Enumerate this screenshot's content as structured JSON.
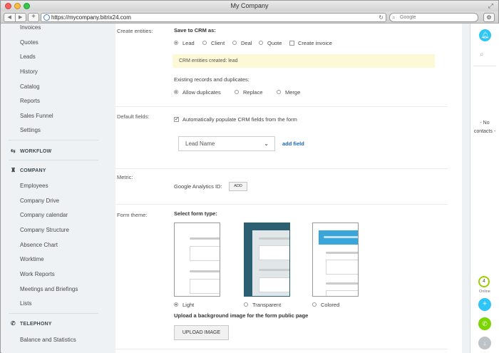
{
  "window": {
    "title": "My Company"
  },
  "browser": {
    "back": "◀",
    "forward": "▶",
    "new_tab": "+",
    "url": "https://mycompany.bitrix24.com",
    "search_placeholder": "Google"
  },
  "sidebar": {
    "items_top": [
      "Invoices",
      "Quotes",
      "Leads",
      "History",
      "Catalog",
      "Reports",
      "Sales Funnel",
      "Settings"
    ],
    "section_workflow": "WORKFLOW",
    "section_company": "COMPANY",
    "company_items": [
      "Employees",
      "Company Drive",
      "Company calendar",
      "Company Structure",
      "Absence Chart",
      "Worktime",
      "Work Reports",
      "Meetings and Briefings",
      "Lists"
    ],
    "section_telephony": "TELEPHONY",
    "telephony_items": [
      "Balance and Statistics"
    ]
  },
  "form": {
    "create_entities": {
      "label": "Create entities:",
      "heading": "Save to CRM as:",
      "options": [
        "Lead",
        "Client",
        "Deal",
        "Quote"
      ],
      "selected": "Lead",
      "invoice_label": "Create invoice",
      "notice": "CRM entities created: lead",
      "duplicates_label": "Existing records and duplicates:",
      "duplicate_options": [
        "Allow duplicates",
        "Replace",
        "Merge"
      ],
      "duplicate_selected": "Allow duplicates"
    },
    "default_fields": {
      "label": "Default fields:",
      "auto_populate": "Automatically populate CRM fields from the form",
      "auto_populate_checked": true,
      "field_value": "Lead Name",
      "add_field": "add field"
    },
    "metric": {
      "label": "Metric:",
      "ga_label": "Google Analytics ID:",
      "add_button": "ADD"
    },
    "theme": {
      "label": "Form theme:",
      "heading": "Select form type:",
      "options": [
        "Light",
        "Transparent",
        "Colored"
      ],
      "selected": "Light",
      "upload_heading": "Upload a background image for the form public page",
      "upload_button": "UPLOAD IMAGE"
    }
  },
  "right_panel": {
    "no_contacts": "- No contacts -",
    "online_count": "4",
    "online_label": "Online"
  },
  "colors": {
    "accent": "#2fc6f6",
    "link": "#2067b0",
    "notice_bg": "#fdf8d6",
    "online_ring": "#9dcf00",
    "phone": "#7bd500",
    "theme_dark": "#2d5f72",
    "theme_colored": "#3aa5d9"
  }
}
